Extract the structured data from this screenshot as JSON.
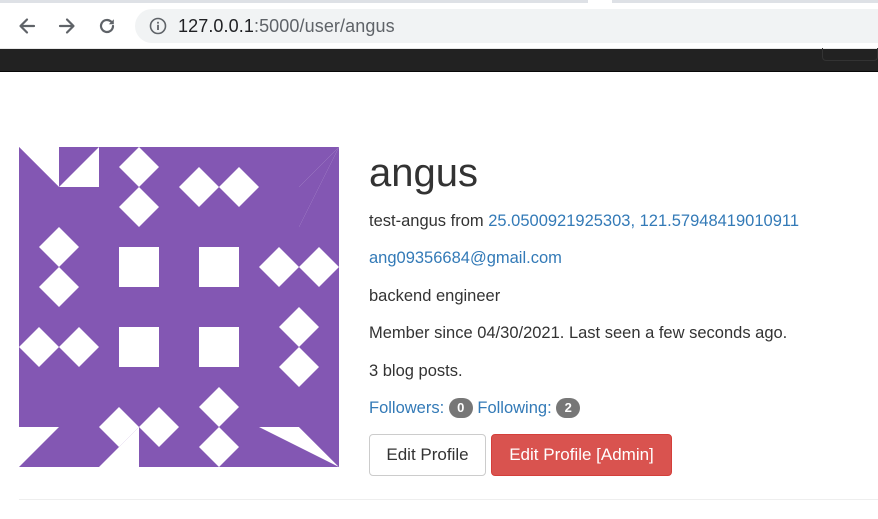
{
  "browser": {
    "url_host": "127.0.0.1",
    "url_rest": ":5000/user/angus",
    "icons": {
      "back": "arrow-left-icon",
      "forward": "arrow-right-icon",
      "reload": "reload-icon",
      "site_info": "info-circle-icon"
    }
  },
  "colors": {
    "avatar": "#8357b3",
    "link": "#337ab7",
    "danger": "#d9534f",
    "badge": "#777777",
    "navbar": "#222222"
  },
  "profile": {
    "username": "angus",
    "name": "test-angus",
    "from_label": "from",
    "location": "25.0500921925303, 121.57948419010911",
    "email": "ang09356684@gmail.com",
    "about": "backend engineer",
    "member_since": "Member since 04/30/2021. Last seen a few seconds ago.",
    "posts": "3 blog posts.",
    "followers_label": "Followers:",
    "followers_count": "0",
    "following_label": "Following:",
    "following_count": "2"
  },
  "actions": {
    "edit_profile": "Edit Profile",
    "edit_profile_admin": "Edit Profile [Admin]"
  }
}
